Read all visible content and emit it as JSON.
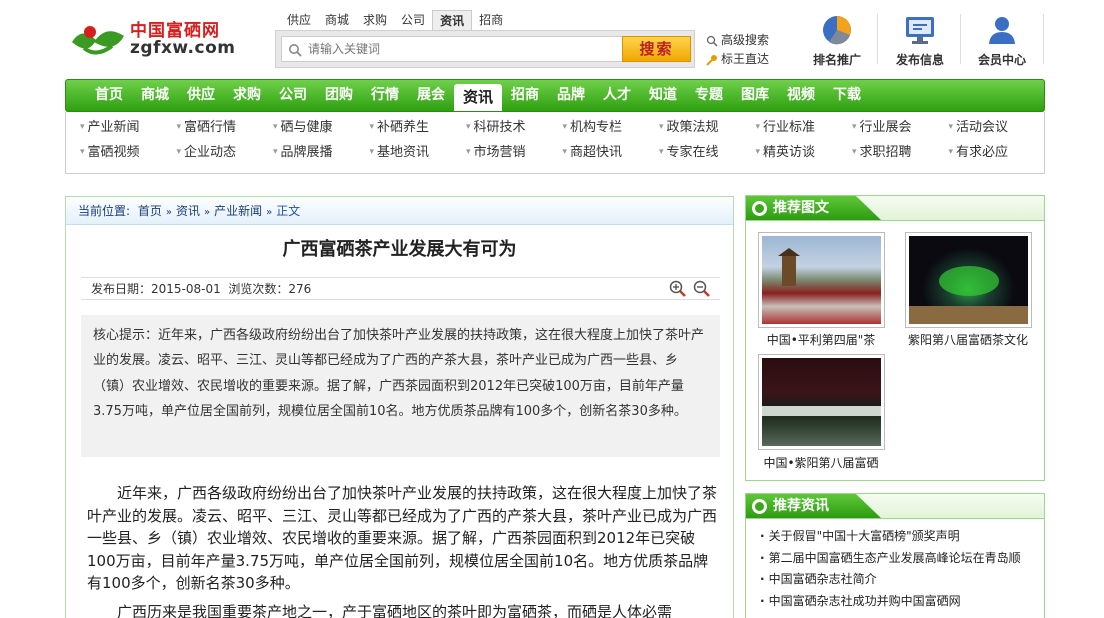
{
  "header": {
    "logo": {
      "cn": "中国富硒网",
      "en": "zgfxw.com"
    },
    "search_tabs": [
      "供应",
      "商城",
      "求购",
      "公司",
      "资讯",
      "招商"
    ],
    "search_tab_active": 4,
    "search_placeholder": "请输入关键词",
    "search_button": "搜索",
    "links": {
      "advanced": "高级搜索",
      "king": "标王直达"
    },
    "quick_icons": [
      {
        "label": "排名推广",
        "icon": "pie-chart-icon"
      },
      {
        "label": "发布信息",
        "icon": "monitor-icon"
      },
      {
        "label": "会员中心",
        "icon": "user-icon"
      }
    ]
  },
  "nav": {
    "items": [
      "首页",
      "商城",
      "供应",
      "求购",
      "公司",
      "团购",
      "行情",
      "展会",
      "资讯",
      "招商",
      "品牌",
      "人才",
      "知道",
      "专题",
      "图库",
      "视频",
      "下载"
    ],
    "active": 8
  },
  "subnav": {
    "row1": [
      "产业新闻",
      "富硒行情",
      "硒与健康",
      "补硒养生",
      "科研技术",
      "机构专栏",
      "政策法规",
      "行业标准",
      "行业展会",
      "活动会议"
    ],
    "row2": [
      "富硒视频",
      "企业动态",
      "品牌展播",
      "基地资讯",
      "市场营销",
      "商超快讯",
      "专家在线",
      "精英访谈",
      "求职招聘",
      "有求必应"
    ]
  },
  "breadcrumb": {
    "label": "当前位置:",
    "items": [
      "首页",
      "资讯",
      "产业新闻"
    ],
    "current": "正文"
  },
  "article": {
    "title": "广西富硒茶产业发展大有可为",
    "meta": "发布日期：2015-08-01  浏览次数：276",
    "summary": "核心提示：近年来，广西各级政府纷纷出台了加快茶叶产业发展的扶持政策，这在很大程度上加快了茶叶产业的发展。凌云、昭平、三江、灵山等都已经成为了广西的产茶大县，茶叶产业已成为广西一些县、乡（镇）农业增效、农民增收的重要来源。据了解，广西茶园面积到2012年已突破100万亩，目前年产量3.75万吨，单产位居全国前列，规模位居全国前10名。地方优质茶品牌有100多个，创新名茶30多种。",
    "body": "近年来，广西各级政府纷纷出台了加快茶叶产业发展的扶持政策，这在很大程度上加快了茶叶产业的发展。凌云、昭平、三江、灵山等都已经成为了广西的产茶大县，茶叶产业已成为广西一些县、乡（镇）农业增效、农民增收的重要来源。据了解，广西茶园面积到2012年已突破100万亩，目前年产量3.75万吨，单产位居全国前列，规模位居全国前10名。地方优质茶品牌有100多个，创新名茶30多种。",
    "body2": "广西历来是我国重要茶产地之一，产于富硒地区的茶叶即为富硒茶，而硒是人体必需"
  },
  "sidebar": {
    "pics_title": "推荐图文",
    "pics": [
      {
        "caption": "中国•平利第四届\"茶"
      },
      {
        "caption": "紫阳第八届富硒茶文化"
      },
      {
        "caption": "中国•紫阳第八届富硒"
      }
    ],
    "news_title": "推荐资讯",
    "news": [
      "关于假冒\"中国十大富硒榜\"颁奖声明",
      "第二届中国富硒生态产业发展高峰论坛在青岛顺",
      "中国富硒杂志社简介",
      "中国富硒杂志社成功并购中国富硒网"
    ]
  },
  "colors": {
    "nav_green": "#2ea010",
    "logo_red": "#d62020",
    "search_orange": "#f0a800"
  }
}
